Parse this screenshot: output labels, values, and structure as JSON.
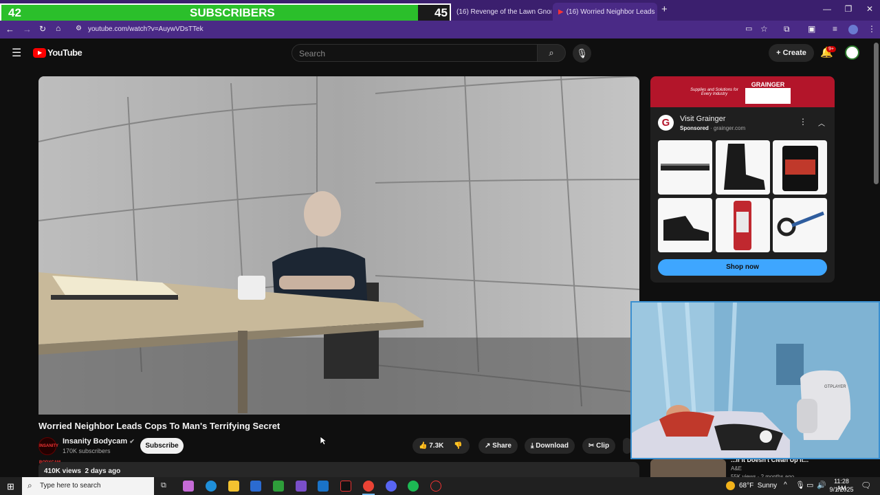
{
  "subscriber_goal": {
    "current": "42",
    "label": "SUBSCRIBERS",
    "goal": "45",
    "progress": 0.93,
    "fill_color": "#2bbf2b"
  },
  "browser": {
    "tabs": [
      {
        "title": "(16) Revenge of the Lawn Gnome",
        "close": "×"
      },
      {
        "title": "(16) Worried Neighbor Leads",
        "close": "×"
      }
    ],
    "new_tab": "+",
    "url": "youtube.com/watch?v=AuywVDsTTek",
    "window_controls": [
      "—",
      "❐",
      "✕"
    ],
    "theme_color": "#4a2a86"
  },
  "youtube": {
    "logo_text": "YouTube",
    "search_placeholder": "Search",
    "create_label": "Create",
    "notification_badge": "9+"
  },
  "video": {
    "title": "Worried Neighbor Leads Cops To Man's Terrifying Secret",
    "channel": {
      "name": "Insanity Bodycam",
      "subscribers": "170K subscribers",
      "avatar_text": "INSANITY BODYCAM"
    },
    "subscribe_label": "Subscribe",
    "likes": "7.3K",
    "share_label": "Share",
    "download_label": "Download",
    "clip_label": "Clip",
    "stats": "410K views  2 days ago"
  },
  "ad": {
    "banner_brand": "GRAINGER",
    "banner_tagline": "Supplies and Solutions for Every Industry",
    "title": "Visit Grainger",
    "sponsored": "Sponsored",
    "domain": "grainger.com",
    "cta": "Shop now",
    "products": [
      "level-icon",
      "work-boot-icon",
      "bucket-icon",
      "shoe-icon",
      "sealant-icon",
      "tool-icon"
    ]
  },
  "sidebar_peek": {
    "title": "...If It Doesn't Clean Up It...",
    "channel": "A&E",
    "meta": "55K views · 2 months ago"
  },
  "webcam": {
    "chair_brand": "GTPLAYER"
  },
  "taskbar": {
    "search_placeholder": "Type here to search",
    "weather": "68°F  Sunny",
    "time": "11:28 AM",
    "date": "9/1/2025"
  }
}
